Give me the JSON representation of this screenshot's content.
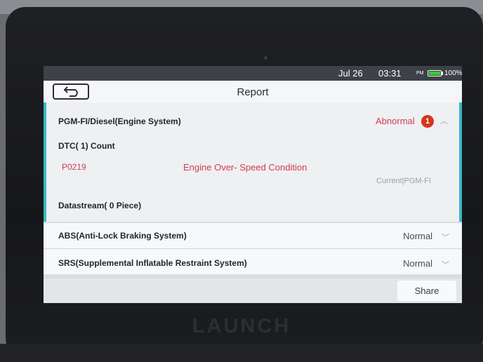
{
  "status_bar": {
    "date": "Jul 26",
    "time": "03:31",
    "ampm": "PM",
    "battery": "100%"
  },
  "header": {
    "title": "Report"
  },
  "sections": [
    {
      "name": "PGM-FI/Diesel(Engine System)",
      "status": "Abnormal",
      "badge": "1",
      "dtc_header": "DTC( 1) Count",
      "dtc": {
        "code": "P0219",
        "description": "Engine Over- Speed Condition",
        "meta": "Current|PGM-FI"
      },
      "datastream": "Datastream( 0 Piece)"
    },
    {
      "name": "ABS(Anti-Lock Braking System)",
      "status": "Normal"
    },
    {
      "name": "SRS(Supplemental Inflatable Restraint System)",
      "status": "Normal"
    }
  ],
  "footer": {
    "share_label": "Share"
  },
  "device": {
    "brand": "LAUNCH"
  },
  "colors": {
    "accent": "#3ab7c9",
    "abnormal": "#d23b52",
    "badge": "#d6341f",
    "battery": "#2fd02f"
  },
  "icons": {
    "back": "back-arrow-icon",
    "expand": "chevron-up-icon",
    "collapse": "chevron-down-icon",
    "battery": "battery-icon"
  }
}
